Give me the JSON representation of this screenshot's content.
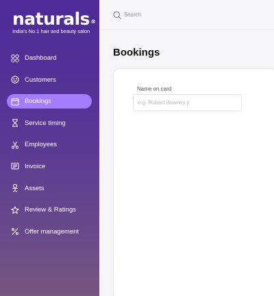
{
  "brand": {
    "name": "naturals",
    "registered": "®",
    "tagline": "India's No.1 hair and beauty salon"
  },
  "sidebar": {
    "items": [
      {
        "label": "Dashboard",
        "icon": "dashboard-icon",
        "active": false
      },
      {
        "label": "Customers",
        "icon": "smiley-icon",
        "active": false
      },
      {
        "label": "Bookings",
        "icon": "calendar-icon",
        "active": true
      },
      {
        "label": "Service timing",
        "icon": "hourglass-icon",
        "active": false
      },
      {
        "label": "Employees",
        "icon": "scissors-icon",
        "active": false
      },
      {
        "label": "Invoice",
        "icon": "invoice-icon",
        "active": false
      },
      {
        "label": "Assets",
        "icon": "chair-icon",
        "active": false
      },
      {
        "label": "Review & Ratings",
        "icon": "star-icon",
        "active": false
      },
      {
        "label": "Offer management",
        "icon": "percent-icon",
        "active": false
      }
    ]
  },
  "topbar": {
    "search_placeholder": "Search"
  },
  "main": {
    "title": "Bookings",
    "form": {
      "name_label": "Name on card",
      "name_placeholder": "e.g. Robert downey jr",
      "name_value": ""
    }
  },
  "colors": {
    "sidebar_top": "#4d2a98",
    "sidebar_bottom": "#75577f",
    "active_item": "#a57cff"
  }
}
